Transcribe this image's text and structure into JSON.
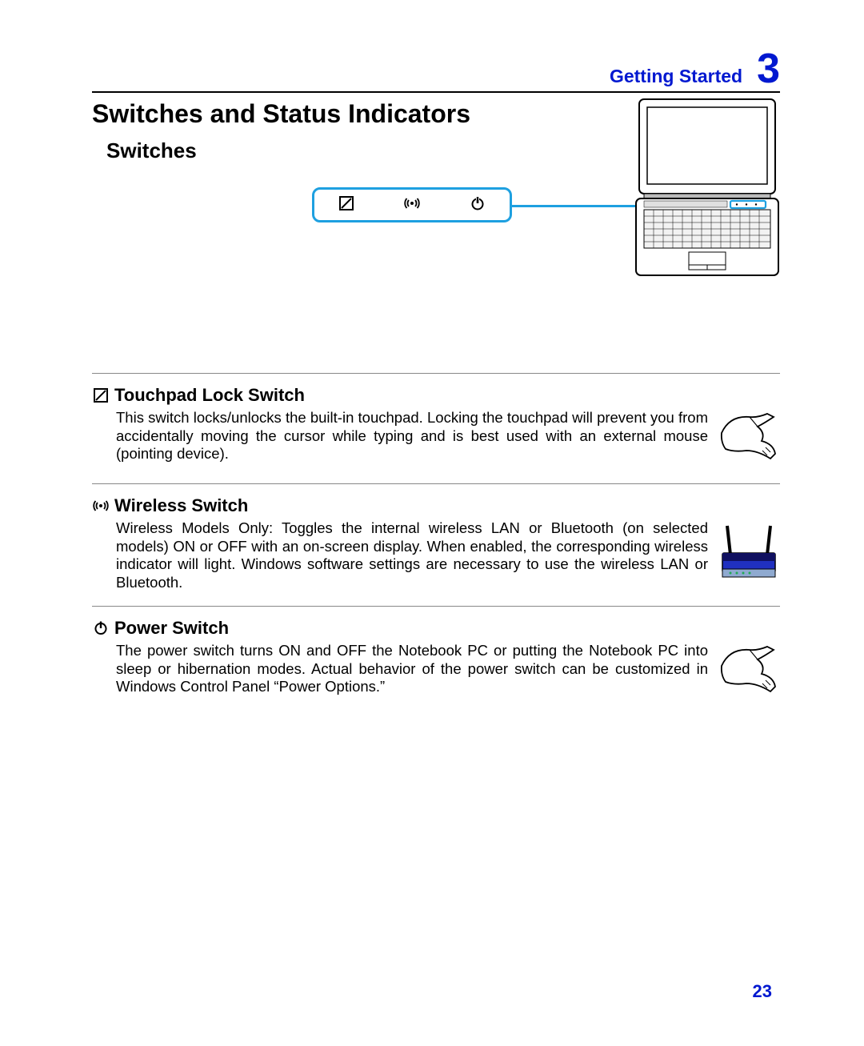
{
  "header": {
    "section_label": "Getting Started",
    "chapter_number": "3"
  },
  "titles": {
    "main": "Switches and Status Indicators",
    "sub": "Switches"
  },
  "callout": {
    "icons": [
      "touchpad-lock-icon",
      "wireless-icon",
      "power-icon"
    ]
  },
  "sections": [
    {
      "icon": "touchpad-lock-icon",
      "heading": "Touchpad Lock Switch",
      "text": "This switch locks/unlocks the built-in touchpad. Locking the touchpad will prevent you from accidentally moving the cursor while typing and is best used with an external mouse (pointing device).",
      "image": "hand-press-icon"
    },
    {
      "icon": "wireless-icon",
      "heading": "Wireless Switch",
      "text": "Wireless Models Only: Toggles the internal wireless LAN or Bluetooth (on selected models) ON or OFF with an on-screen display. When enabled, the corresponding wireless indicator will light. Windows software settings are necessary to use the wireless LAN or Bluetooth.",
      "image": "router-icon"
    },
    {
      "icon": "power-icon",
      "heading": "Power Switch",
      "text": "The power switch turns ON and OFF the Notebook PC or putting the Notebook PC into sleep or hibernation modes. Actual behavior of the power switch can be customized in Windows Control Panel “Power Options.”",
      "image": "hand-press-icon"
    }
  ],
  "page_number": "23"
}
